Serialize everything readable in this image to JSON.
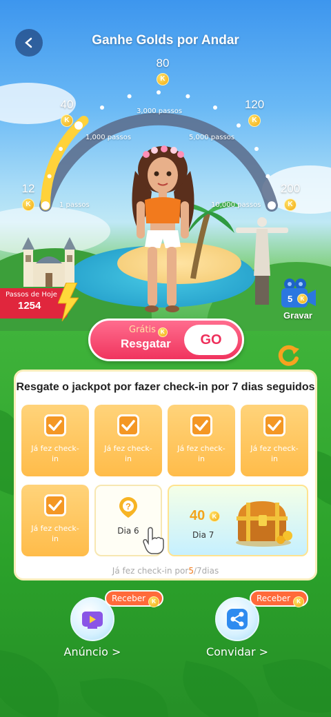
{
  "header": {
    "title": "Ganhe Golds por Andar"
  },
  "gauge": {
    "milestones": [
      {
        "value": "12",
        "steps": "1 passos"
      },
      {
        "value": "40",
        "steps": "1,000 passos"
      },
      {
        "value": "80",
        "steps": "3,000 passos"
      },
      {
        "value": "120",
        "steps": "5,000 passos"
      },
      {
        "value": "200",
        "steps": "10,000 passos"
      }
    ],
    "coin_symbol": "K",
    "progress_fraction": 0.27
  },
  "today": {
    "label": "Passos de Hoje",
    "steps": "1254"
  },
  "record": {
    "count": "5",
    "label": "Gravar"
  },
  "claim": {
    "free_label": "Grátis",
    "claim_label": "Resgatar",
    "go_label": "GO"
  },
  "checkin": {
    "title": "Resgate o jackpot por fazer check-in por 7 dias seguidos",
    "done_label": "Já fez check-in",
    "day6_label": "Dia 6",
    "day7_label": "Dia 7",
    "day7_reward": "40",
    "progress_prefix": "Já fez check-in por",
    "progress_done": "5",
    "progress_suffix": "/7dias"
  },
  "actions": [
    {
      "label": "Anúncio >",
      "badge": "Receber"
    },
    {
      "label": "Convidar >",
      "badge": "Receber"
    }
  ],
  "colors": {
    "accent": "#f0345e",
    "gold": "#f2a70f",
    "green": "#2ba12a"
  }
}
